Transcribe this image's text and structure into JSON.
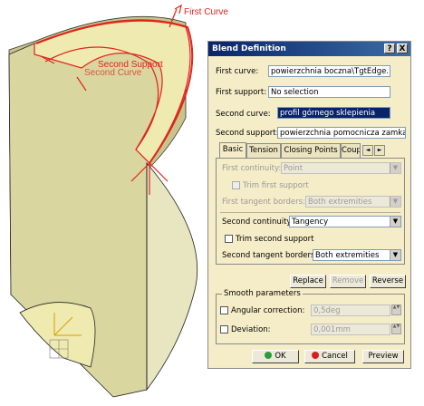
{
  "viewport": {
    "labels": {
      "first_curve": "First Curve",
      "second_support": "Second Support",
      "second_curve": "Second Curve"
    },
    "colors": {
      "surface": "#d9d6a0",
      "accent": "#e0241d",
      "background": "#ffffff"
    }
  },
  "dialog": {
    "title": "Blend Definition",
    "help_button": "?",
    "close_button": "X",
    "first_curve_label": "First curve:",
    "first_curve_value": "powierzchnia boczna\\TgtEdge.1",
    "first_support_label": "First support:",
    "first_support_value": "No selection",
    "second_curve_label": "Second curve:",
    "second_curve_value": "profil górnego sklepienia",
    "second_support_label": "Second support:",
    "second_support_value": "powierzchnia pomocnicza zamka",
    "tabs": [
      "Basic",
      "Tension",
      "Closing Points",
      "Coup"
    ],
    "tab_scroll_left": "◄",
    "tab_scroll_right": "►",
    "basic": {
      "first_continuity_label": "First continuity:",
      "first_continuity_value": "Point",
      "trim_first_support_label": "Trim first support",
      "first_tangent_borders_label": "First tangent borders:",
      "first_tangent_borders_value": "Both extremities",
      "second_continuity_label": "Second continuity:",
      "second_continuity_value": "Tangency",
      "trim_second_support_label": "Trim second support",
      "second_tangent_borders_label": "Second tangent borders:",
      "second_tangent_borders_value": "Both extremities"
    },
    "actions": {
      "replace": "Replace",
      "remove": "Remove",
      "reverse": "Reverse"
    },
    "smooth": {
      "title": "Smooth parameters",
      "angular_label": "Angular correction:",
      "angular_value": "0,5deg",
      "deviation_label": "Deviation:",
      "deviation_value": "0,001mm"
    },
    "footer": {
      "ok": "OK",
      "cancel": "Cancel",
      "preview": "Preview"
    },
    "colors": {
      "titlebar": "#0a246a",
      "panel": "#f5ecc8",
      "ok_icon": "#2a9d3a",
      "cancel_icon": "#d32020"
    }
  }
}
